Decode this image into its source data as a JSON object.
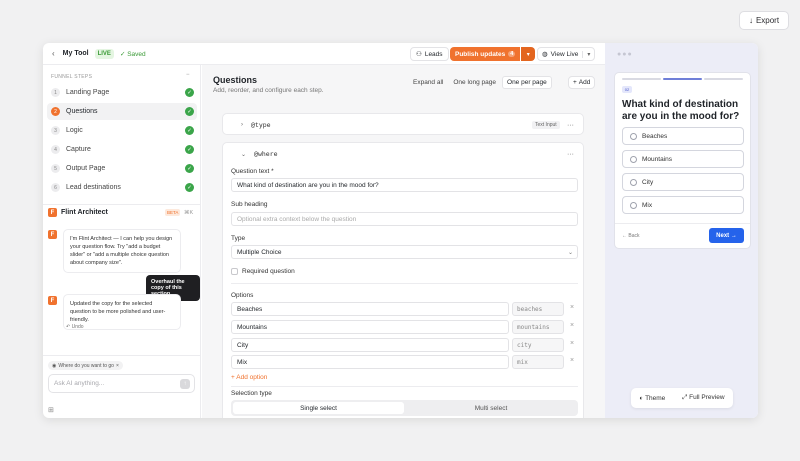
{
  "export": {
    "label": "Export",
    "icon": "download-icon"
  },
  "topbar": {
    "title": "My Tool",
    "live_badge": "LIVE",
    "saved": "Saved",
    "leads": "Leads",
    "publish": "Publish updates",
    "publish_count": "4",
    "view_live": "View Live"
  },
  "sidebar": {
    "steps_header": "FUNNEL STEPS",
    "steps": [
      {
        "num": "1",
        "label": "Landing Page"
      },
      {
        "num": "2",
        "label": "Questions"
      },
      {
        "num": "3",
        "label": "Logic"
      },
      {
        "num": "4",
        "label": "Capture"
      },
      {
        "num": "5",
        "label": "Output Page"
      },
      {
        "num": "6",
        "label": "Lead destinations"
      }
    ],
    "active_step": 2
  },
  "ai": {
    "name": "Flint Architect",
    "beta": "BETA",
    "shortcut": "⌘K",
    "msg1": "I'm Flint Architect — I can help you design your question flow. Try \"add a budget slider\" or \"add a multiple choice question about company size\".",
    "user_msg": "Overhaul the copy of this section",
    "msg2": "Updated the copy for the selected question to be more polished and user-friendly.",
    "undo": "Undo",
    "context_chip": "Where do you want to go",
    "ask_placeholder": "Ask AI anything..."
  },
  "main": {
    "title": "Questions",
    "subtitle": "Add, reorder, and configure each step.",
    "tabs": [
      "Expand all",
      "One long page",
      "One per page"
    ],
    "active_tab": "One per page",
    "add": "Add",
    "card1": {
      "var": "@type",
      "tag": "Text Input"
    },
    "card2": {
      "var": "@where",
      "question_label": "Question text *",
      "question_value": "What kind of destination are you in the mood for?",
      "subheading_label": "Sub heading",
      "subheading_placeholder": "Optional extra context below the question",
      "type_label": "Type",
      "type_value": "Multiple Choice",
      "required_label": "Required question",
      "options_label": "Options",
      "options": [
        {
          "label": "Beaches",
          "value": "beaches"
        },
        {
          "label": "Mountains",
          "value": "mountains"
        },
        {
          "label": "City",
          "value": "city"
        },
        {
          "label": "Mix",
          "value": "mix"
        }
      ],
      "add_option": "+ Add option",
      "selection_label": "Selection type",
      "selection_single": "Single select",
      "selection_multi": "Multi select"
    }
  },
  "preview": {
    "badge": "02",
    "question": "What kind of destination are you in the mood for?",
    "choices": [
      "Beaches",
      "Mountains",
      "City",
      "Mix"
    ],
    "back": "← Back",
    "next": "Next →",
    "theme": "Theme",
    "full_preview": "Full Preview",
    "progress_step": 2,
    "progress_total": 3
  },
  "colors": {
    "accent": "#f0722e",
    "success": "#3ba54a",
    "primary": "#2563eb"
  }
}
